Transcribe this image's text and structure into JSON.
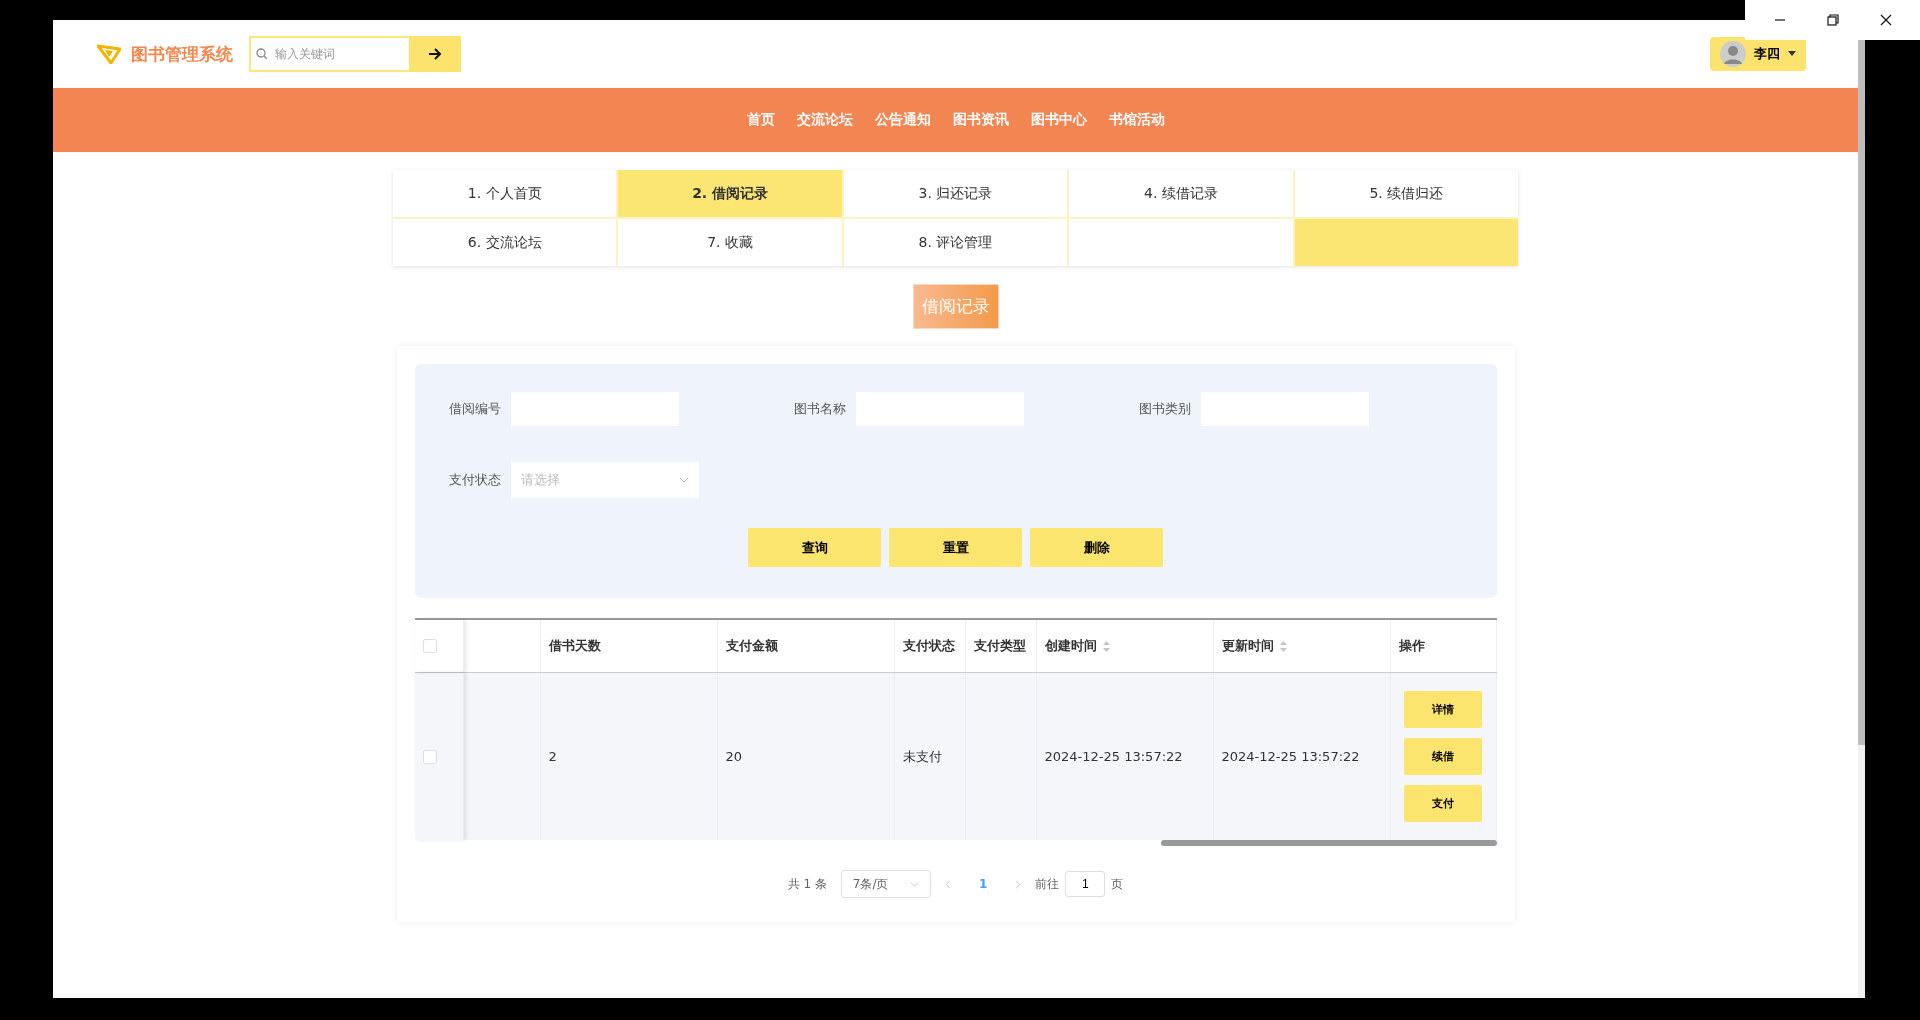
{
  "header": {
    "brand": "图书管理系统",
    "search": {
      "placeholder": "输入关键词"
    },
    "user": {
      "name": "李四"
    }
  },
  "nav": [
    {
      "label": "首页"
    },
    {
      "label": "交流论坛"
    },
    {
      "label": "公告通知"
    },
    {
      "label": "图书资讯"
    },
    {
      "label": "图书中心"
    },
    {
      "label": "书馆活动"
    }
  ],
  "tabs": [
    {
      "label": "1. 个人首页",
      "selected": false
    },
    {
      "label": "2. 借阅记录",
      "selected": true
    },
    {
      "label": "3. 归还记录",
      "selected": false
    },
    {
      "label": "4. 续借记录",
      "selected": false
    },
    {
      "label": "5. 续借归还",
      "selected": false
    },
    {
      "label": "6. 交流论坛",
      "selected": false
    },
    {
      "label": "7. 收藏",
      "selected": false
    },
    {
      "label": "8. 评论管理",
      "selected": false
    }
  ],
  "page_title": "借阅记录",
  "filters": [
    {
      "kind": "text",
      "label": "借阅编号"
    },
    {
      "kind": "text",
      "label": "图书名称"
    },
    {
      "kind": "text",
      "label": "图书类别"
    },
    {
      "kind": "select",
      "label": "支付状态",
      "placeholder": "请选择"
    }
  ],
  "filter_buttons": [
    "查询",
    "重置",
    "删除"
  ],
  "table": {
    "select_all_checked": false,
    "columns": [
      {
        "label": "借书天数",
        "sortable": false
      },
      {
        "label": "支付金额",
        "sortable": false
      },
      {
        "label": "支付状态",
        "sortable": false
      },
      {
        "label": "支付类型",
        "sortable": false
      },
      {
        "label": "创建时间",
        "sortable": true
      },
      {
        "label": "更新时间",
        "sortable": true
      },
      {
        "label": "操作",
        "sortable": false
      }
    ],
    "rows": [
      {
        "checked": false,
        "cells": [
          "2",
          "20",
          "未支付",
          "",
          "2024-12-25 13:57:22",
          "2024-12-25 13:57:22"
        ],
        "actions": [
          "详情",
          "续借",
          "支付"
        ]
      }
    ]
  },
  "pagination": {
    "total": "共 1 条",
    "page_size": "7条/页",
    "pages": [
      {
        "label": "1",
        "selected": true
      }
    ],
    "goto_label": "前往",
    "goto_value": "1",
    "goto_suffix": "页"
  }
}
